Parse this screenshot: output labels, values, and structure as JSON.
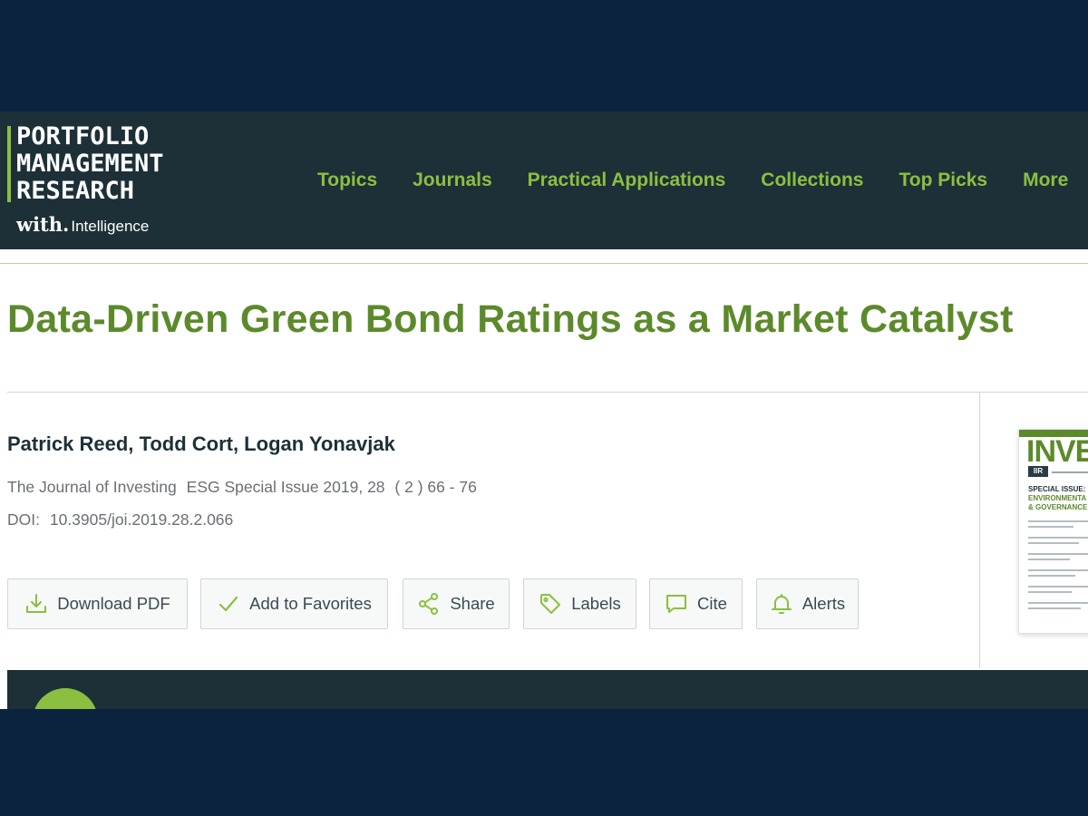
{
  "header": {
    "logo_lines": [
      "PORTFOLIO",
      "MANAGEMENT",
      "RESEARCH"
    ],
    "logo_with": "with.",
    "logo_intelligence": "Intelligence",
    "nav": [
      "Topics",
      "Journals",
      "Practical Applications",
      "Collections",
      "Top Picks",
      "More"
    ]
  },
  "article": {
    "title": "Data-Driven Green Bond Ratings as a Market Catalyst",
    "authors": "Patrick Reed, Todd Cort, Logan Yonavjak",
    "journal": "The Journal of Investing",
    "issue": "ESG Special Issue 2019, 28",
    "number": "( 2 ) 66 - 76",
    "doi_label": "DOI:",
    "doi": "10.3905/joi.2019.28.2.066"
  },
  "actions": [
    {
      "label": "Download PDF",
      "icon": "download-icon"
    },
    {
      "label": "Add to Favorites",
      "icon": "check-icon"
    },
    {
      "label": "Share",
      "icon": "share-icon"
    },
    {
      "label": "Labels",
      "icon": "tag-icon"
    },
    {
      "label": "Cite",
      "icon": "speech-bubble-icon"
    },
    {
      "label": "Alerts",
      "icon": "bell-icon"
    }
  ],
  "cover": {
    "title": "INVE",
    "badge": "IIR",
    "special": "SPECIAL ISSUE:",
    "sub1": "ENVIRONMENTA",
    "sub2": "& GOVERNANCE"
  },
  "colors": {
    "accent_green": "#8cbf3f",
    "title_green": "#5c8a2b",
    "header_bg": "#1d3038",
    "frame_bg": "#0c2340"
  }
}
